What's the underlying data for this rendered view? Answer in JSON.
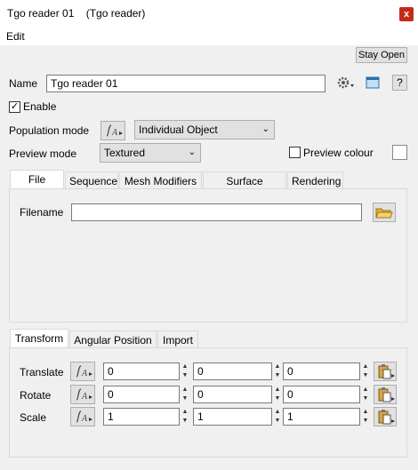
{
  "window": {
    "title": "Tgo reader 01    (Tgo reader)",
    "close_glyph": "x"
  },
  "menu": {
    "edit": "Edit"
  },
  "toolbar": {
    "stay_open": "Stay Open"
  },
  "name": {
    "label": "Name",
    "value": "Tgo reader 01",
    "help": "?"
  },
  "enable": {
    "label": "Enable",
    "checked": true
  },
  "population": {
    "label": "Population mode",
    "value": "Individual Object"
  },
  "preview": {
    "label": "Preview mode",
    "value": "Textured",
    "colour_label": "Preview colour",
    "colour_checked": false
  },
  "tabs_top": [
    "File Read",
    "Sequence",
    "Mesh Modifiers",
    "Surface Shaders",
    "Rendering"
  ],
  "file_read": {
    "filename_label": "Filename",
    "filename_value": ""
  },
  "tabs_bottom": [
    "Transform",
    "Angular Position",
    "Import"
  ],
  "transform": {
    "rows": [
      {
        "label": "Translate",
        "values": [
          "0",
          "0",
          "0"
        ]
      },
      {
        "label": "Rotate",
        "values": [
          "0",
          "0",
          "0"
        ]
      },
      {
        "label": "Scale",
        "values": [
          "1",
          "1",
          "1"
        ]
      }
    ]
  },
  "icons": {
    "gear": "gear-icon",
    "preview": "preview-window-icon",
    "folder": "folder-open-icon",
    "func": "function-a-icon",
    "paste": "paste-icon"
  }
}
